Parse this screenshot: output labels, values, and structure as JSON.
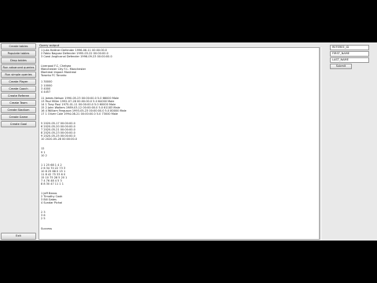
{
  "sidebar": {
    "buttons": [
      "Create tables",
      "Populate tables",
      "Drop tables",
      "Run advanced queries",
      "Run simple queries",
      "Create Player",
      "Create Coach",
      "Create Referee",
      "Create Team",
      "Create Stadium",
      "Create Game",
      "Create Goal"
    ],
    "exit_label": "Exit"
  },
  "output": {
    "label": "Query output",
    "lines": [
      "1 Julia Hattner Defender 1996-06-11 00:00:00.0",
      "2 Fabio Naguez Defender 1995-03-22 00:00:00.0",
      "3 Carol Anglicanal Defender 1996-09-23 00:00:00.0",
      "",
      "",
      "Liverpool F.C. Chelsea",
      "Manchester City F.C. Manchester",
      "Montreal Impact Montreal",
      "Toronto FC Toronto",
      "",
      "1 30000",
      "2 10000",
      "3 4000",
      "4 4457",
      "",
      "11 James Nelson 1990-05-23 00:00:00.0 5.0 66000 Male",
      "13 Paul Miller 1992-07-28 00:00:00.0 5.0 64000 Male",
      "14 1 Tony Paul 1975-01-11 00:00:00.0 5.0 60000 Male",
      "15 2 John Walters 1989-03-12 00:00:00.0 5.0 61183 Male",
      "16 4 William Ferguson 1993-05-23 00:00:00.0 5.0 80000 Male",
      "17 1 Oliver Cole 1994-08-21 00:00:00.0 5.0 73000 Male",
      "",
      "",
      "5 2020-05-17 00:00:00.0",
      "6 2020-05-20 00:00:00.0",
      "7 2020-05-21 00:00:00.0",
      "8 2020-05-23 00:00:00.0",
      "9 2020-05-25 00:00:00.0",
      "10 2020-05-28 00:00:00.0",
      "",
      "",
      "12",
      "9 1",
      "10 2",
      "",
      "",
      "1 1 25 68 1 4 2",
      "2 6 34 70 22 73 3",
      "10 8 25 68 0 15 1",
      "11 8 42 75 33 6 0",
      "15 10 75 28 5 20 1",
      "7 4 76 48 4 5 3",
      "8 8 30 47 11 1 1",
      "",
      "",
      "1 Jeff Bezos",
      "2 Timothy Cook",
      "3 Bill Gates",
      "4 Sundar Pichai",
      "",
      "",
      "2 3",
      "3 6",
      "2 5",
      "",
      "",
      "Success"
    ]
  },
  "form": {
    "referee_id_label": "REFEREE_ID",
    "first_name_label": "FIRST_NAME",
    "last_name_label": "LAST_NAME",
    "submit_label": "Submit"
  }
}
